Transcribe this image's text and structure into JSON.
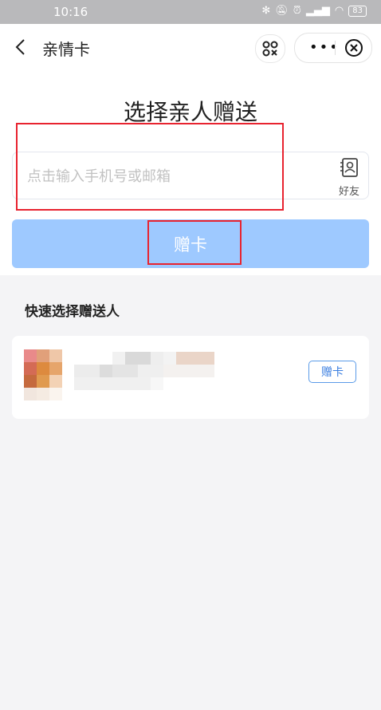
{
  "status_bar": {
    "time": "10:16",
    "battery": "83"
  },
  "nav": {
    "title": "亲情卡"
  },
  "page": {
    "heading": "选择亲人赠送",
    "input_placeholder": "点击输入手机号或邮箱",
    "input_value": "",
    "friends_label": "好友",
    "gift_button": "赠卡"
  },
  "quick_select": {
    "title": "快速选择赠送人",
    "contacts": [
      {
        "name": "",
        "action_label": "赠卡"
      }
    ]
  },
  "colors": {
    "primary_button": "#9ec9ff",
    "highlight_box": "#e8232f",
    "link_blue": "#3a7ee0"
  }
}
